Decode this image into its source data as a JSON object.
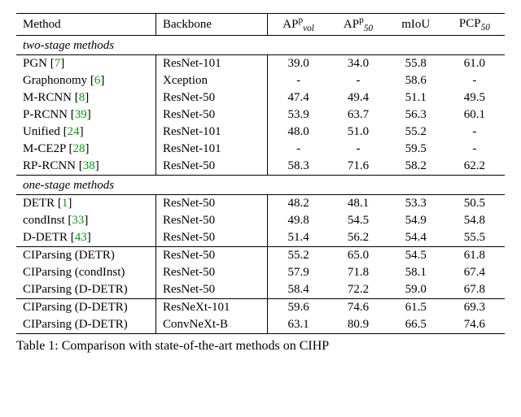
{
  "headers": {
    "method": "Method",
    "backbone": "Backbone",
    "ap_vol_pre": "AP",
    "ap_vol_sub": "vol",
    "ap_vol_sup": "p",
    "ap_50_pre": "AP",
    "ap_50_sub": "50",
    "ap_50_sup": "p",
    "miou": "mIoU",
    "pcp_pre": "PCP",
    "pcp_sub": "50"
  },
  "sections": {
    "two": "two-stage methods",
    "one": "one-stage methods"
  },
  "rows_two": [
    {
      "method": "PGN",
      "cite": "7",
      "backbone": "ResNet-101",
      "ap_vol": "39.0",
      "ap_50": "34.0",
      "miou": "55.8",
      "pcp": "61.0"
    },
    {
      "method": "Graphonomy",
      "cite": "6",
      "backbone": "Xception",
      "ap_vol": "-",
      "ap_50": "-",
      "miou": "58.6",
      "pcp": "-"
    },
    {
      "method": "M-RCNN",
      "cite": "8",
      "backbone": "ResNet-50",
      "ap_vol": "47.4",
      "ap_50": "49.4",
      "miou": "51.1",
      "pcp": "49.5"
    },
    {
      "method": "P-RCNN",
      "cite": "39",
      "backbone": "ResNet-50",
      "ap_vol": "53.9",
      "ap_50": "63.7",
      "miou": "56.3",
      "pcp": "60.1"
    },
    {
      "method": "Unified",
      "cite": "24",
      "backbone": "ResNet-101",
      "ap_vol": "48.0",
      "ap_50": "51.0",
      "miou": "55.2",
      "pcp": "-"
    },
    {
      "method": "M-CE2P",
      "cite": "28",
      "backbone": "ResNet-101",
      "ap_vol": "-",
      "ap_50": "-",
      "miou": "59.5",
      "pcp": "-"
    },
    {
      "method": "RP-RCNN",
      "cite": "38",
      "backbone": "ResNet-50",
      "ap_vol": "58.3",
      "ap_50": "71.6",
      "miou": "58.2",
      "pcp": "62.2"
    }
  ],
  "rows_one_a": [
    {
      "method": "DETR",
      "cite": "1",
      "backbone": "ResNet-50",
      "ap_vol": "48.2",
      "ap_50": "48.1",
      "miou": "53.3",
      "pcp": "50.5"
    },
    {
      "method": "condInst",
      "cite": "33",
      "backbone": "ResNet-50",
      "ap_vol": "49.8",
      "ap_50": "54.5",
      "miou": "54.9",
      "pcp": "54.8"
    },
    {
      "method": "D-DETR",
      "cite": "43",
      "backbone": "ResNet-50",
      "ap_vol": "51.4",
      "ap_50": "56.2",
      "miou": "54.4",
      "pcp": "55.5"
    }
  ],
  "rows_one_b": [
    {
      "method": "CIParsing (DETR)",
      "cite": "",
      "backbone": "ResNet-50",
      "ap_vol": "55.2",
      "ap_50": "65.0",
      "miou": "54.5",
      "pcp": "61.8"
    },
    {
      "method": "CIParsing (condInst)",
      "cite": "",
      "backbone": "ResNet-50",
      "ap_vol": "57.9",
      "ap_50": "71.8",
      "miou": "58.1",
      "pcp": "67.4"
    },
    {
      "method": "CIParsing (D-DETR)",
      "cite": "",
      "backbone": "ResNet-50",
      "ap_vol": "58.4",
      "ap_50": "72.2",
      "miou": "59.0",
      "pcp": "67.8"
    }
  ],
  "rows_one_c": [
    {
      "method": "CIParsing (D-DETR)",
      "cite": "",
      "backbone": "ResNeXt-101",
      "ap_vol": "59.6",
      "ap_50": "74.6",
      "miou": "61.5",
      "pcp": "69.3"
    },
    {
      "method": "CIParsing (D-DETR)",
      "cite": "",
      "backbone": "ConvNeXt-B",
      "ap_vol": "63.1",
      "ap_50": "80.9",
      "miou": "66.5",
      "pcp": "74.6"
    }
  ],
  "caption": "Table 1: Comparison with state-of-the-art methods on CIHP",
  "chart_data": {
    "type": "table",
    "title": "Comparison with state-of-the-art methods on CIHP",
    "columns": [
      "Method",
      "Backbone",
      "AP^p_vol",
      "AP^p_50",
      "mIoU",
      "PCP_50"
    ],
    "sections": [
      {
        "name": "two-stage methods",
        "rows": [
          [
            "PGN [7]",
            "ResNet-101",
            39.0,
            34.0,
            55.8,
            61.0
          ],
          [
            "Graphonomy [6]",
            "Xception",
            null,
            null,
            58.6,
            null
          ],
          [
            "M-RCNN [8]",
            "ResNet-50",
            47.4,
            49.4,
            51.1,
            49.5
          ],
          [
            "P-RCNN [39]",
            "ResNet-50",
            53.9,
            63.7,
            56.3,
            60.1
          ],
          [
            "Unified [24]",
            "ResNet-101",
            48.0,
            51.0,
            55.2,
            null
          ],
          [
            "M-CE2P [28]",
            "ResNet-101",
            null,
            null,
            59.5,
            null
          ],
          [
            "RP-RCNN [38]",
            "ResNet-50",
            58.3,
            71.6,
            58.2,
            62.2
          ]
        ]
      },
      {
        "name": "one-stage methods",
        "rows": [
          [
            "DETR [1]",
            "ResNet-50",
            48.2,
            48.1,
            53.3,
            50.5
          ],
          [
            "condInst [33]",
            "ResNet-50",
            49.8,
            54.5,
            54.9,
            54.8
          ],
          [
            "D-DETR [43]",
            "ResNet-50",
            51.4,
            56.2,
            54.4,
            55.5
          ],
          [
            "CIParsing (DETR)",
            "ResNet-50",
            55.2,
            65.0,
            54.5,
            61.8
          ],
          [
            "CIParsing (condInst)",
            "ResNet-50",
            57.9,
            71.8,
            58.1,
            67.4
          ],
          [
            "CIParsing (D-DETR)",
            "ResNet-50",
            58.4,
            72.2,
            59.0,
            67.8
          ],
          [
            "CIParsing (D-DETR)",
            "ResNeXt-101",
            59.6,
            74.6,
            61.5,
            69.3
          ],
          [
            "CIParsing (D-DETR)",
            "ConvNeXt-B",
            63.1,
            80.9,
            66.5,
            74.6
          ]
        ]
      }
    ]
  }
}
